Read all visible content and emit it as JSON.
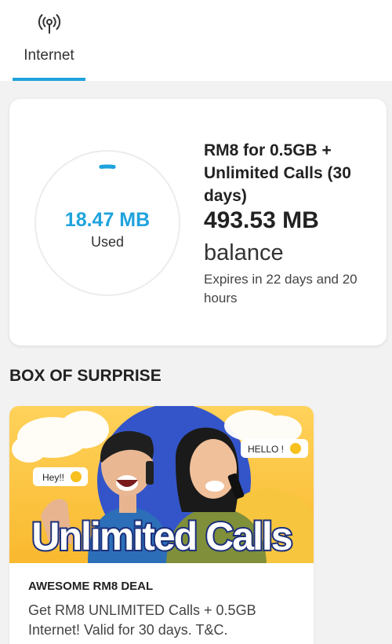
{
  "tabs": [
    {
      "label": "Internet",
      "icon": "antenna-icon",
      "active": true
    }
  ],
  "usage": {
    "used_value": "18.47 MB",
    "used_label": "Used",
    "used_fraction": 0.036,
    "accent_color": "#1fa3dd"
  },
  "plan": {
    "name": "RM8 for 0.5GB + Unlimited Calls (30 days)",
    "balance": "493.53 MB",
    "balance_label": "balance",
    "expiry": "Expires in 22 days and 20 hours"
  },
  "section": {
    "title": "BOX OF SURPRISE"
  },
  "promo": {
    "banner": {
      "headline": "Unlimited Calls",
      "bubble_left": "Hey!!",
      "bubble_right": "HELLO !"
    },
    "title": "AWESOME RM8 DEAL",
    "description": "Get RM8 UNLIMITED Calls + 0.5GB Internet! Valid for 30 days. T&C."
  }
}
